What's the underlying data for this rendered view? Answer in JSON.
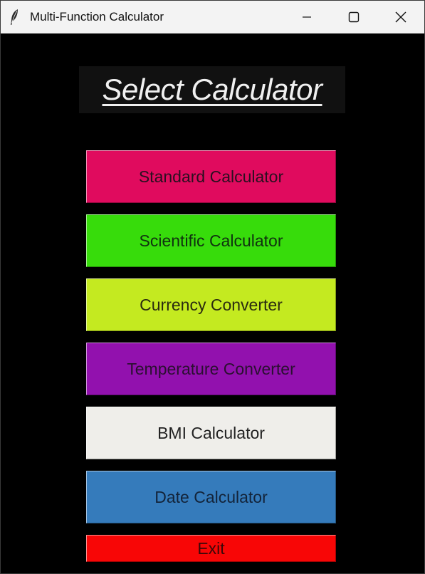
{
  "window": {
    "title": "Multi-Function Calculator",
    "icon": "feather-icon",
    "controls": [
      "minimize-icon",
      "maximize-icon",
      "close-icon"
    ]
  },
  "heading": {
    "text": "Select Calculator"
  },
  "buttons": [
    {
      "label": "Standard Calculator",
      "bg": "#E00B5E",
      "fg": "#2a1020"
    },
    {
      "label": "Scientific Calculator",
      "bg": "#37DC0B",
      "fg": "#103010"
    },
    {
      "label": "Currency Converter",
      "bg": "#C4EA20",
      "fg": "#2a2a10"
    },
    {
      "label": "Temperature Converter",
      "bg": "#9211AE",
      "fg": "#2a1030"
    },
    {
      "label": "BMI Calculator",
      "bg": "#EFEEEA",
      "fg": "#222222"
    },
    {
      "label": "Date Calculator",
      "bg": "#357BBB",
      "fg": "#13243a"
    }
  ],
  "exit": {
    "label": "Exit",
    "bg": "#F80606",
    "fg": "#3a0808"
  }
}
